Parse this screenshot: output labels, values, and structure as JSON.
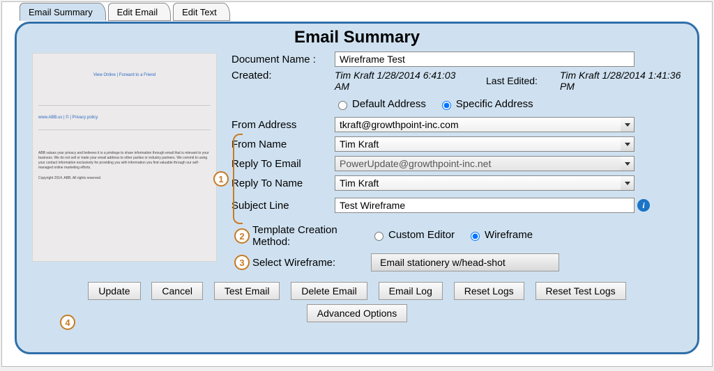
{
  "tabs": {
    "summary": "Email Summary",
    "edit_email": "Edit Email",
    "edit_text": "Edit Text"
  },
  "heading": "Email Summary",
  "thumbnail": {
    "topline": "View Online | Forward to a Friend",
    "midline": "www.ABB.us | © | Privacy policy",
    "finetext": "ABB values your privacy and believes it is a privilege to share information through email that is relevant to your business. We do not sell or trade your email address to other parties or industry partners. We commit to using your contact information exclusively for providing you with information you find valuable through our self-managed online marketing efforts.",
    "copyright": "Copyright 2014. ABB. All rights reserved."
  },
  "fields": {
    "doc_name_label": "Document Name :",
    "doc_name_value": "Wireframe Test",
    "created_label": "Created:",
    "created_value": "Tim Kraft 1/28/2014 6:41:03 AM",
    "lastedited_label": "Last Edited:",
    "lastedited_value": "Tim Kraft 1/28/2014 1:41:36 PM",
    "radio_default": "Default Address",
    "radio_specific": "Specific Address",
    "from_addr_label": "From Address",
    "from_addr_value": "tkraft@growthpoint-inc.com",
    "from_name_label": "From Name",
    "from_name_value": "Tim Kraft",
    "reply_email_label": "Reply To Email",
    "reply_email_value": "PowerUpdate@growthpoint-inc.net",
    "reply_name_label": "Reply To Name",
    "reply_name_value": "Tim Kraft",
    "subject_label": "Subject Line",
    "subject_value": "Test Wireframe",
    "method_label": "Template Creation Method:",
    "method_custom": "Custom Editor",
    "method_wireframe": "Wireframe",
    "selectwf_label": "Select Wireframe:",
    "selectwf_value": "Email stationery w/head-shot"
  },
  "callouts": {
    "c1": "1",
    "c2": "2",
    "c3": "3",
    "c4": "4"
  },
  "buttons": {
    "update": "Update",
    "cancel": "Cancel",
    "test": "Test Email",
    "delete": "Delete Email",
    "log": "Email Log",
    "reset_logs": "Reset Logs",
    "reset_test": "Reset Test Logs",
    "advanced": "Advanced Options"
  },
  "info_glyph": "i"
}
